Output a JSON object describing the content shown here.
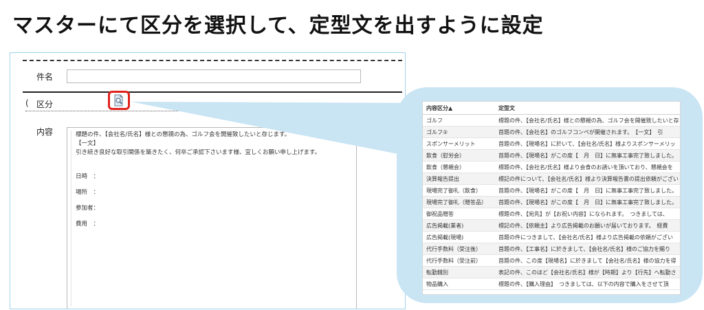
{
  "headline": "マスターにて区分を選択して、定型文を出すように設定",
  "form": {
    "subject_label": "件名",
    "subject_value": "",
    "category_label": "区分",
    "category_prefix": "(",
    "body_label": "内容",
    "body_lines": [
      "標題の件、【会社名/氏名】様との懇親の為、ゴルフ会を開催致したいと存じます。",
      "【一文】",
      "引き続き良好な取引関係を築きたく、何卒ご承認下さいます様、宜しくお願い申し上げます。"
    ],
    "fields": [
      "日時　：",
      "場所　：",
      "参加者：",
      "費用　："
    ]
  },
  "picker": {
    "headers": [
      "内容区分▲",
      "定型文"
    ],
    "rows": [
      [
        "ゴルフ",
        "標題の件、【会社名/氏名】様との懇親の為、ゴルフ会を開催致したいと存"
      ],
      [
        "ゴルフ②",
        "首題の件、【会社名】のゴルフコンペが開催されます。　【一文】　引"
      ],
      [
        "スポンサーメリット",
        "首題の件、【現場名】に於いて、【会社名/氏名】様よりスポンサーメリッ"
      ],
      [
        "飲食（慰労会）",
        "首題の件、【現場名】がこの度【　月　日】に無事工事完了致しました。"
      ],
      [
        "飲食（懇親会）",
        "標題の件、【会社名/氏名】様より会食のお誘いを頂いており、懇親会を"
      ],
      [
        "決算報告提出",
        "標記の件について、【会社名/氏名】様より決算報告書の提出依頼がござい"
      ],
      [
        "現場完了御礼（飲食）",
        "首題の件、【現場名】がこの度【　月　日】に無事工事完了致しました。"
      ],
      [
        "現場完了御礼（贈答品）",
        "首題の件、【現場名】がこの度【　月　日】に無事工事完了致しました。"
      ],
      [
        "御祝品贈答",
        "標題の件、【宛先】が【お祝い内容】になられます。　つきましては、"
      ],
      [
        "広告掲載(業者)",
        "標記の件、【依頼主】より広告掲載のお願いが届いております。　経費"
      ],
      [
        "広告掲載(現場)",
        "首題の件につきまして、【会社名/氏名】様より広告掲載の依頼がござい"
      ],
      [
        "代行手数料（受注後）",
        "首題の件、【工事名】に於きまして、【会社名/氏名】様のご協力を賜り"
      ],
      [
        "代行手数料（受注前）",
        "首題の件、この度【現場名】に於きまして【会社名/氏名】様の協力を得"
      ],
      [
        "転勤餞別",
        "表記の件、このほど【会社名/氏名】様が【時期】より【行先】へ転勤さ"
      ],
      [
        "物品購入",
        "標題の件、【購入理由】　つきましては、以下の内容で購入をさせて頂"
      ]
    ]
  },
  "icons": {
    "picker": "document-search-icon"
  },
  "colors": {
    "highlight": "#e0201a",
    "bubble": "#c9e4f3",
    "panel_border": "#9fd3ea"
  }
}
